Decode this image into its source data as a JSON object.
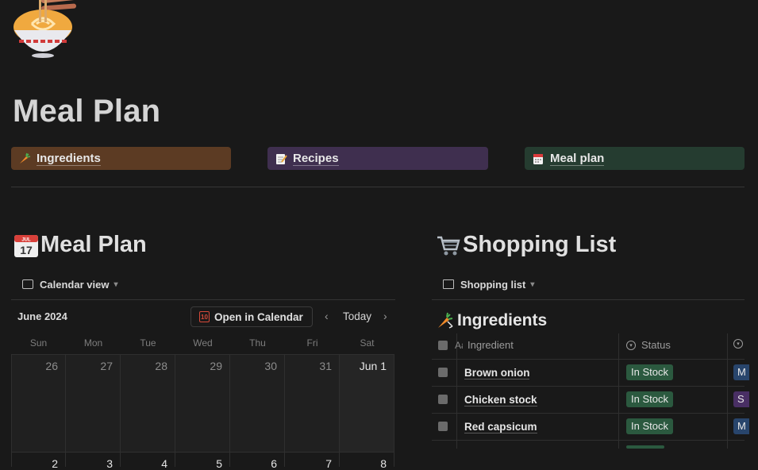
{
  "page": {
    "title": "Meal Plan",
    "icon": "ramen-bowl-icon"
  },
  "nav_links": [
    {
      "label": "Ingredients",
      "icon": "carrot-icon",
      "color": "#5c3b23"
    },
    {
      "label": "Recipes",
      "icon": "memo-icon",
      "color": "#3f2f4f"
    },
    {
      "label": "Meal plan",
      "icon": "calendar-icon",
      "color": "#253c30"
    }
  ],
  "meal_plan": {
    "title": "Meal Plan",
    "icon": "calendar-icon",
    "view": {
      "label": "Calendar view",
      "icon": "calendar-view-icon"
    },
    "month": "June 2024",
    "open_button": {
      "label": "Open in Calendar",
      "icon_text": "10"
    },
    "today_label": "Today",
    "prev_label": "‹",
    "next_label": "›",
    "weekdays": [
      "Sun",
      "Mon",
      "Tue",
      "Wed",
      "Thu",
      "Fri",
      "Sat"
    ],
    "week1": [
      "26",
      "27",
      "28",
      "29",
      "30",
      "31",
      "Jun 1"
    ],
    "week2": [
      "2",
      "3",
      "4",
      "5",
      "6",
      "7",
      "8"
    ]
  },
  "shopping_list": {
    "title": "Shopping List",
    "icon": "shopping-cart-icon",
    "view": {
      "label": "Shopping list",
      "icon": "table-icon"
    },
    "db_title": "Ingredients",
    "db_icon": "carrot-icon",
    "columns": {
      "col0_prefix": "Aa",
      "ingredient": "Ingredient",
      "status": "Status"
    },
    "rows": [
      {
        "name": "Brown onion",
        "status": "In Stock",
        "extra": "M",
        "extra_color": "#28456c"
      },
      {
        "name": "Chicken stock",
        "status": "In Stock",
        "extra": "S",
        "extra_color": "#492f64"
      },
      {
        "name": "Red capsicum",
        "status": "In Stock",
        "extra": "M",
        "extra_color": "#28456c"
      }
    ],
    "status_color": "#2b593f"
  }
}
